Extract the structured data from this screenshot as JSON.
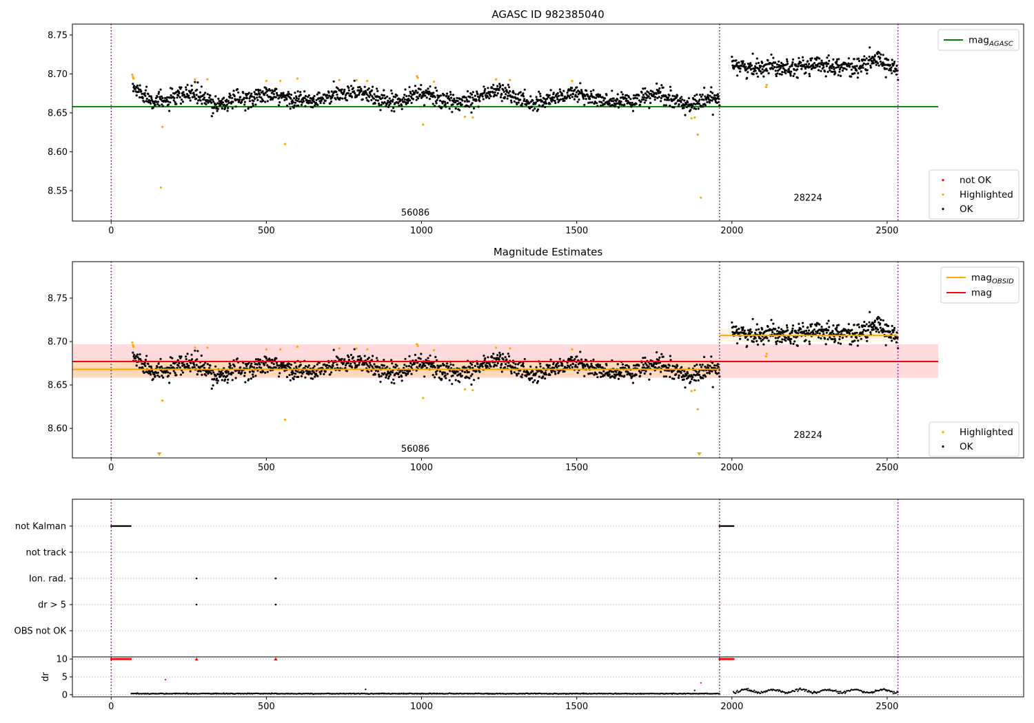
{
  "chart_data": [
    {
      "type": "scatter",
      "title": "AGASC ID 982385040",
      "xlim": [
        -125,
        2940
      ],
      "ylim": [
        8.511,
        8.764
      ],
      "x_ticks": [
        0,
        500,
        1000,
        1500,
        2000,
        2500
      ],
      "y_ticks": [
        8.55,
        8.6,
        8.65,
        8.7,
        8.75
      ],
      "vlines": [
        0,
        1960,
        2535
      ],
      "hlines": [
        {
          "name": "mag_AGASC",
          "y": 8.658,
          "x": [
            -125,
            2665
          ],
          "color": "#008000"
        }
      ],
      "obsid_labels": [
        {
          "text": "56086",
          "x": 980,
          "y": 8.518
        },
        {
          "text": "28224",
          "x": 2245,
          "y": 8.537
        }
      ],
      "legends": [
        {
          "position": "top-right",
          "entries": [
            {
              "label": "mag",
              "sub": "AGASC",
              "kind": "line",
              "color": "#008000"
            }
          ]
        },
        {
          "position": "bottom-right",
          "entries": [
            {
              "label": "not OK",
              "kind": "dot",
              "color": "#ff0000"
            },
            {
              "label": "Highlighted",
              "kind": "dot",
              "color": "#ffa500"
            },
            {
              "label": "OK",
              "kind": "dot",
              "color": "#000000"
            }
          ]
        }
      ],
      "series": [
        {
          "name": "OK",
          "color": "#000000",
          "segments": [
            {
              "x": [
                70,
                1960
              ],
              "level": [
                [
                  70,
                  8.682
                ],
                [
                  130,
                  8.668
                ],
                [
                  170,
                  8.664
                ],
                [
                  260,
                  8.676
                ],
                [
                  330,
                  8.661
                ],
                [
                  500,
                  8.673
                ],
                [
                  650,
                  8.664
                ],
                [
                  780,
                  8.679
                ],
                [
                  900,
                  8.664
                ],
                [
                  1000,
                  8.676
                ],
                [
                  1100,
                  8.662
                ],
                [
                  1250,
                  8.679
                ],
                [
                  1350,
                  8.662
                ],
                [
                  1500,
                  8.676
                ],
                [
                  1600,
                  8.663
                ],
                [
                  1700,
                  8.667
                ],
                [
                  1760,
                  8.674
                ],
                [
                  1850,
                  8.66
                ],
                [
                  1960,
                  8.67
                ]
              ],
              "spread": 0.008,
              "n": 1420
            },
            {
              "x": [
                2000,
                2535
              ],
              "level": [
                [
                  2000,
                  8.716
                ],
                [
                  2050,
                  8.706
                ],
                [
                  2120,
                  8.711
                ],
                [
                  2200,
                  8.709
                ],
                [
                  2300,
                  8.712
                ],
                [
                  2400,
                  8.708
                ],
                [
                  2470,
                  8.719
                ],
                [
                  2535,
                  8.705
                ]
              ],
              "spread": 0.008,
              "n": 430
            }
          ]
        },
        {
          "name": "Highlighted",
          "color": "#ffa500",
          "points": [
            [
              68,
              8.699
            ],
            [
              70,
              8.696
            ],
            [
              72,
              8.694
            ],
            [
              160,
              8.554
            ],
            [
              165,
              8.632
            ],
            [
              270,
              8.693
            ],
            [
              310,
              8.693
            ],
            [
              500,
              8.691
            ],
            [
              545,
              8.691
            ],
            [
              560,
              8.61
            ],
            [
              600,
              8.694
            ],
            [
              735,
              8.692
            ],
            [
              790,
              8.692
            ],
            [
              825,
              8.691
            ],
            [
              985,
              8.697
            ],
            [
              988,
              8.695
            ],
            [
              1005,
              8.635
            ],
            [
              1040,
              8.69
            ],
            [
              1140,
              8.645
            ],
            [
              1165,
              8.644
            ],
            [
              1240,
              8.693
            ],
            [
              1285,
              8.692
            ],
            [
              1485,
              8.691
            ],
            [
              1870,
              8.643
            ],
            [
              1880,
              8.644
            ],
            [
              1890,
              8.622
            ],
            [
              1900,
              8.541
            ],
            [
              2110,
              8.683
            ],
            [
              2112,
              8.686
            ]
          ]
        },
        {
          "name": "not OK",
          "color": "#ff0000",
          "points": []
        }
      ]
    },
    {
      "type": "scatter",
      "title": "Magnitude Estimates",
      "xlim": [
        -125,
        2940
      ],
      "ylim": [
        8.566,
        8.792
      ],
      "x_ticks": [
        0,
        500,
        1000,
        1500,
        2000,
        2500
      ],
      "y_ticks": [
        8.6,
        8.65,
        8.7,
        8.75
      ],
      "vlines": [
        0,
        1960,
        2535
      ],
      "hlines": [
        {
          "name": "mag",
          "y": 8.677,
          "x": [
            -125,
            2665
          ],
          "color": "#ff0000",
          "band": [
            8.658,
            8.697
          ],
          "band_color": "#ffcccf"
        },
        {
          "name": "mag_OBSID 56086",
          "y": 8.668,
          "x": [
            -125,
            1960
          ],
          "color": "#ffa500",
          "band": [
            8.66,
            8.676
          ],
          "band_color": "#ffd8a8"
        },
        {
          "name": "mag_OBSID 28224",
          "y": 8.707,
          "x": [
            1960,
            2535
          ],
          "color": "#ffa500",
          "band": [
            8.7,
            8.715
          ],
          "band_color": "#fff1d6"
        }
      ],
      "obsid_labels": [
        {
          "text": "56086",
          "x": 980,
          "y": 8.573
        },
        {
          "text": "28224",
          "x": 2245,
          "y": 8.589
        }
      ],
      "legends": [
        {
          "position": "top-right",
          "entries": [
            {
              "label": "mag",
              "sub": "OBSID",
              "kind": "line",
              "color": "#ffa500"
            },
            {
              "label": "mag",
              "kind": "line",
              "color": "#ff0000"
            }
          ]
        },
        {
          "position": "bottom-right",
          "entries": [
            {
              "label": "Highlighted",
              "kind": "dot",
              "color": "#ffa500"
            },
            {
              "label": "OK",
              "kind": "dot",
              "color": "#000000"
            }
          ]
        }
      ],
      "out_of_range_markers": [
        {
          "x": 155,
          "color": "#ffa500"
        },
        {
          "x": 1895,
          "color": "#ffa500"
        }
      ]
    },
    {
      "type": "scatter",
      "title": "",
      "ylabel": "",
      "xlim": [
        -125,
        2940
      ],
      "categories": [
        "not Kalman",
        "not track",
        "Ion. rad.",
        "dr > 5",
        "OBS not OK"
      ],
      "flags": [
        {
          "category": "not Kalman",
          "ranges": [
            [
              0,
              65
            ],
            [
              1960,
              2005
            ]
          ]
        },
        {
          "category": "not track",
          "ranges": []
        },
        {
          "category": "Ion. rad.",
          "points": [
            275,
            530
          ]
        },
        {
          "category": "dr > 5",
          "points": [
            275,
            530
          ]
        },
        {
          "category": "OBS not OK",
          "ranges": []
        }
      ],
      "vlines": [
        0,
        1960,
        2535
      ]
    },
    {
      "type": "scatter",
      "title": "",
      "ylabel": "dr",
      "xlim": [
        -125,
        2940
      ],
      "ylim": [
        -0.6,
        10.6
      ],
      "x_ticks": [
        0,
        500,
        1000,
        1500,
        2000,
        2500
      ],
      "y_ticks": [
        0,
        5,
        10
      ],
      "vlines": [
        0,
        1960,
        2535
      ],
      "red_points_at_10": {
        "ranges": [
          [
            0,
            65
          ],
          [
            1960,
            2005
          ]
        ],
        "points": [
          275,
          530
        ]
      },
      "red_points_other": [
        [
          175,
          4.2
        ],
        [
          1900,
          3.3
        ]
      ],
      "black_points_other": [
        [
          820,
          1.5
        ],
        [
          1880,
          1.2
        ]
      ],
      "black_segments": [
        {
          "x": [
            65,
            1960
          ],
          "y": 0.3,
          "spread": 0.15
        },
        {
          "x": [
            2005,
            2535
          ],
          "y": 1.0,
          "spread": 0.6
        }
      ]
    }
  ]
}
